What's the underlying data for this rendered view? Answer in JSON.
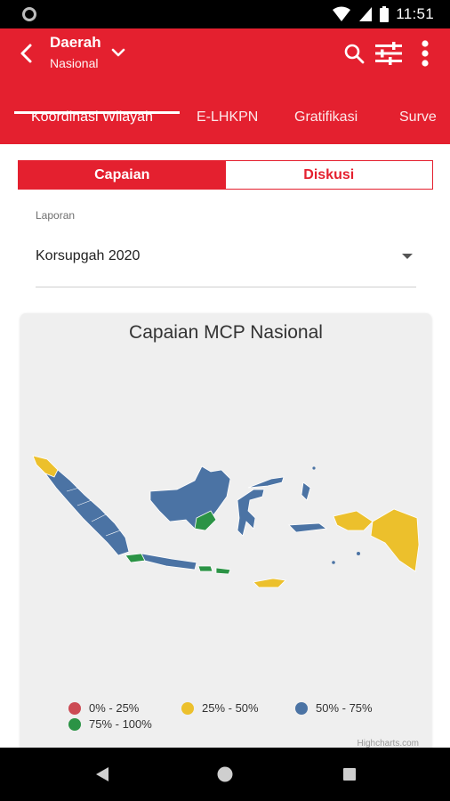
{
  "status_bar": {
    "time": "11:51"
  },
  "app_bar": {
    "title": "Daerah",
    "subtitle": "Nasional"
  },
  "tabs": [
    {
      "label": "Koordinasi Wilayah",
      "active": true
    },
    {
      "label": "E-LHKPN",
      "active": false
    },
    {
      "label": "Gratifikasi",
      "active": false
    },
    {
      "label": "Surve",
      "active": false
    }
  ],
  "segmented": {
    "left": "Capaian",
    "right": "Diskusi",
    "selected": "Capaian"
  },
  "field": {
    "label": "Laporan",
    "value": "Korsupgah 2020"
  },
  "chart_data": {
    "type": "map",
    "title": "Capaian MCP Nasional",
    "legend": [
      {
        "label": "0% - 25%",
        "color": "#cc4b54"
      },
      {
        "label": "25% - 50%",
        "color": "#ecc02c"
      },
      {
        "label": "50% - 75%",
        "color": "#4b73a4"
      },
      {
        "label": "75% - 100%",
        "color": "#2b9345"
      }
    ],
    "credits": "Highcharts.com"
  },
  "colors": {
    "brand": "#e4202f",
    "category_low": "#cc4b54",
    "category_mid_low": "#ecc02c",
    "category_mid_high": "#4b73a4",
    "category_high": "#2b9345"
  }
}
